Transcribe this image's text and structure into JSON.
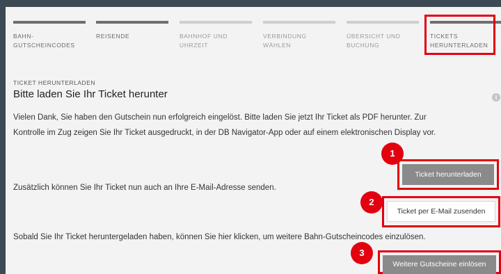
{
  "steps": [
    {
      "label": "BAHN- GUTSCHEINCODES",
      "state": "done"
    },
    {
      "label": "REISENDE",
      "state": "done"
    },
    {
      "label": "BAHNHOF UND UHRZEIT",
      "state": "future"
    },
    {
      "label": "VERBINDUNG WÄHLEN",
      "state": "future"
    },
    {
      "label": "ÜBERSICHT UND BUCHUNG",
      "state": "future"
    },
    {
      "label": "TICKETS HERUNTERLADEN",
      "state": "current"
    }
  ],
  "section_label": "TICKET HERUNTERLADEN",
  "title": "Bitte laden Sie Ihr Ticket herunter",
  "info_icon": "info-icon",
  "paragraph1_line1": "Vielen Dank, Sie haben den Gutschein nun erfolgreich eingelöst. Bitte laden Sie jetzt Ihr Ticket als PDF herunter. Zur",
  "paragraph1_line2": "Kontrolle im Zug zeigen Sie Ihr Ticket ausgedruckt, in der DB Navigator-App oder auf einem elektronischen Display vor.",
  "paragraph2": "Zusätzlich können Sie Ihr Ticket nun auch an Ihre E-Mail-Adresse senden.",
  "paragraph3": "Sobald Sie Ihr Ticket heruntergeladen haben, können Sie hier klicken, um weitere Bahn-Gutscheincodes einzulösen.",
  "buttons": {
    "download": "Ticket herunterladen",
    "email": "Ticket per E-Mail zusenden",
    "redeem": "Weitere Gutscheine einlösen"
  },
  "badges": [
    "1",
    "2",
    "3"
  ],
  "colors": {
    "highlight": "#e3000f",
    "background": "#3c4a55",
    "panel": "#f3f3f3",
    "button_gray": "#8a8a8a"
  }
}
